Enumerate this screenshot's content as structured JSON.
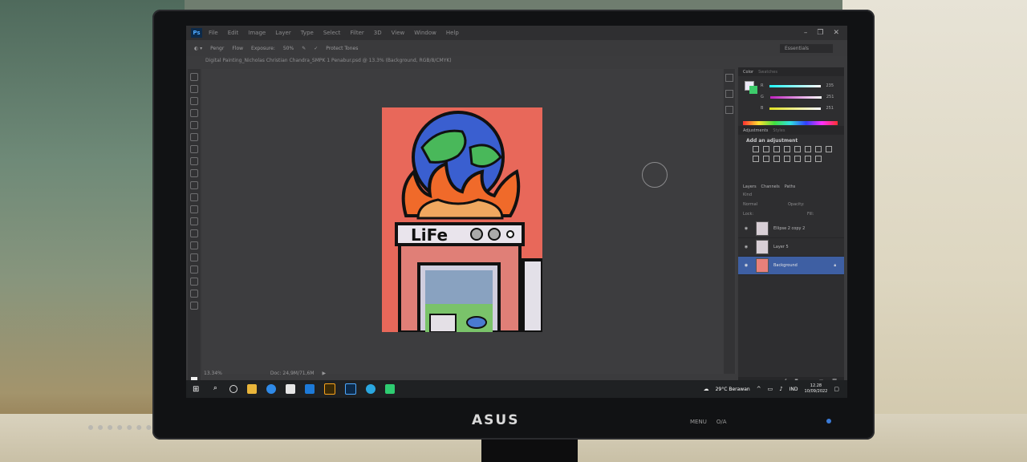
{
  "menu": [
    "File",
    "Edit",
    "Image",
    "Layer",
    "Type",
    "Select",
    "Filter",
    "3D",
    "View",
    "Window",
    "Help"
  ],
  "options_bar": {
    "flow_label": "Pengr",
    "flow_value": "Flow",
    "exposure_label": "Exposure:",
    "exposure_value": "50%",
    "protect_tones": "Protect Tones",
    "workspace": "Essentials"
  },
  "document_tab": "Digital Painting_Nicholas Christian Chandra_SMPK 1 Penabur.psd @ 13.3% (Background, RGB/8/CMYK)",
  "poster_text": "LiFe",
  "status": {
    "zoom": "13.34%",
    "doc": "Doc: 24,9M/71,6M"
  },
  "color_panel": {
    "tab_color": "Color",
    "tab_swatches": "Swatches",
    "channels": [
      {
        "label": "R",
        "value": "235"
      },
      {
        "label": "G",
        "value": "251"
      },
      {
        "label": "B",
        "value": "251"
      }
    ]
  },
  "adjustments": {
    "tab": "Adjustments",
    "tab2": "Styles",
    "title": "Add an adjustment"
  },
  "layers_panel": {
    "tabs": [
      "Layers",
      "Channels",
      "Paths"
    ],
    "kind": "Kind",
    "blend": "Normal",
    "opacity": "Opacity:",
    "lock": "Lock:",
    "fill": "Fill:",
    "layers": [
      {
        "name": "Ellipse 2 copy 2",
        "active": false
      },
      {
        "name": "Layer 5",
        "active": false
      },
      {
        "name": "Background",
        "active": true
      }
    ]
  },
  "taskbar": {
    "weather": "29°C Berawan",
    "language": "IND",
    "time": "12.28",
    "date": "10/09/2022"
  },
  "monitor_brand": "ASUS",
  "monitor_buttons": [
    "MENU",
    "O/A"
  ],
  "colors": {
    "accent": "#3e5fa3",
    "canvas": "#e8685a"
  }
}
